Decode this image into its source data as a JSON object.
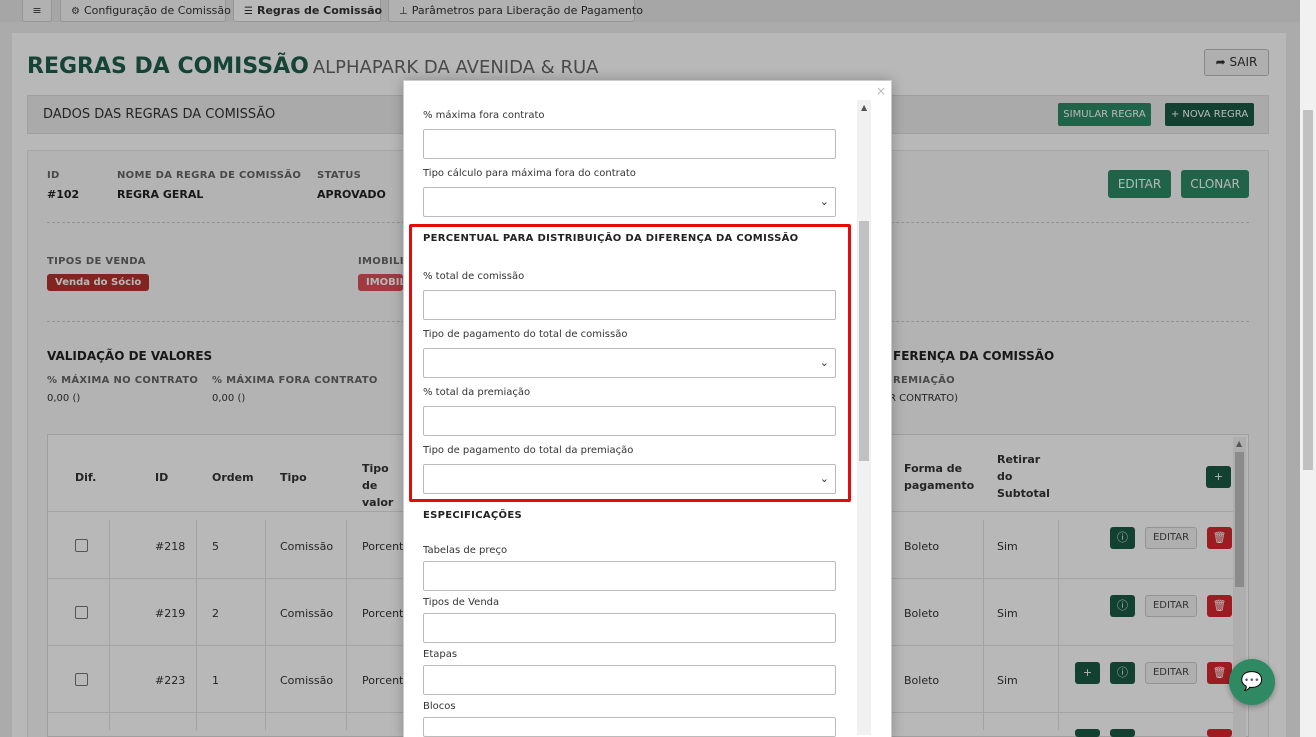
{
  "tabs": [
    {
      "label": "≡",
      "icon": "menu-icon"
    },
    {
      "label": "Configuração de Comissão",
      "icon": "gear-icon"
    },
    {
      "label": "Regras de Comissão",
      "icon": "list-icon",
      "active": true
    },
    {
      "label": "Parâmetros para Liberação de Pagamento",
      "icon": "sitemap-icon"
    }
  ],
  "header": {
    "title": "REGRAS DA COMISSÃO",
    "subtitle": "ALPHAPARK DA AVENIDA & RUA",
    "exit_label": "SAIR"
  },
  "section": {
    "title": "DADOS DAS REGRAS DA COMISSÃO",
    "simulate_label": "SIMULAR REGRA",
    "new_label": "+ NOVA REGRA"
  },
  "details": {
    "id_label": "ID",
    "id_value": "#102",
    "name_label": "NOME DA REGRA DE COMISSÃO",
    "name_value": "REGRA GERAL",
    "status_label": "STATUS",
    "status_value": "APROVADO",
    "edit_label": "EDITAR",
    "clone_label": "CLONAR",
    "sale_types_label": "TIPOS DE VENDA",
    "sale_type_badge": "Venda do Sócio",
    "realestate_label": "IMOBILIÁRIAS",
    "realestate_badge": "IMOBILIÁRIA",
    "validation_title": "VALIDAÇÃO DE VALORES",
    "max_contract_label": "% MÁXIMA NO CONTRATO",
    "max_contract_value": "0,00 ()",
    "max_outside_label": "% MÁXIMA FORA CONTRATO",
    "max_outside_value": "0,00 ()",
    "diff_title_partial": "FERENÇA DA COMISSÃO",
    "premium_partial": "REMIAÇÃO",
    "contract_partial": "R CONTRATO)"
  },
  "table": {
    "headers": {
      "dif": "Dif.",
      "id": "ID",
      "ordem": "Ordem",
      "tipo": "Tipo",
      "tipo_valor": "Tipo de valor",
      "forma": "Forma de pagamento",
      "retirar": "Retirar do Subtotal"
    },
    "rows": [
      {
        "id": "#218",
        "ordem": "5",
        "tipo": "Comissão",
        "tipo_valor": "Porcenta",
        "forma": "Boleto",
        "retirar": "Sim",
        "edit": "EDITAR"
      },
      {
        "id": "#219",
        "ordem": "2",
        "tipo": "Comissão",
        "tipo_valor": "Porcenta",
        "forma": "Boleto",
        "retirar": "Sim",
        "edit": "EDITAR"
      },
      {
        "id": "#223",
        "ordem": "1",
        "tipo": "Comissão",
        "tipo_valor": "Porcenta",
        "forma": "Boleto",
        "retirar": "Sim",
        "edit": "EDITAR"
      }
    ],
    "add_label": "+"
  },
  "modal": {
    "close": "×",
    "max_outside_label": "% máxima fora contrato",
    "calc_type_label": "Tipo cálculo para máxima fora do contrato",
    "distribution_title": "PERCENTUAL PARA DISTRIBUIÇÃO DA DIFERENÇA DA COMISSÃO",
    "total_commission_label": "% total de comissão",
    "payment_type_commission_label": "Tipo de pagamento do total de comissão",
    "total_premium_label": "% total da premiação",
    "payment_type_premium_label": "Tipo de pagamento do total da premiação",
    "specs_title": "ESPECIFICAÇÕES",
    "price_tables_label": "Tabelas de preço",
    "sale_types_label": "Tipos de Venda",
    "stages_label": "Etapas",
    "blocks_label": "Blocos"
  },
  "colors": {
    "brand_dark": "#1e5e4a",
    "brand": "#2f8a64",
    "danger": "#d9272e",
    "highlight": "#e30b0b",
    "badge_sale": "#b5322c",
    "badge_realestate": "#e0505a"
  }
}
